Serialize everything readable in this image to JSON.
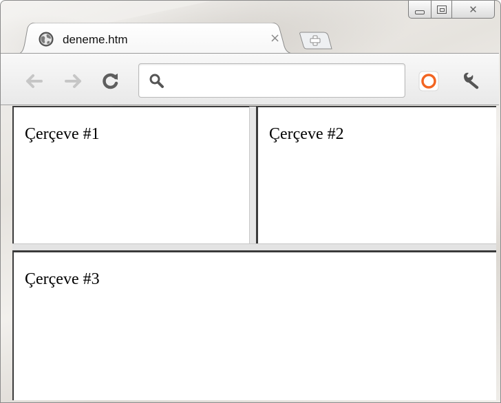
{
  "window": {
    "controls": {
      "minimize": "minimize-icon",
      "maximize": "maximize-icon",
      "close": "close-icon"
    }
  },
  "tab": {
    "title": "deneme.htm",
    "close_glyph": "×",
    "icon": "globe-icon"
  },
  "new_tab": {
    "icon": "new-tab-icon"
  },
  "toolbar": {
    "back_icon": "back-arrow-icon",
    "forward_icon": "forward-arrow-icon",
    "reload_icon": "reload-icon",
    "omnibox": {
      "value": "",
      "icon": "search-icon"
    },
    "extension_icon": "extension-icon",
    "wrench_icon": "wrench-icon"
  },
  "frames": [
    {
      "label": "Çerçeve #1"
    },
    {
      "label": "Çerçeve #2"
    },
    {
      "label": "Çerçeve #3"
    }
  ],
  "colors": {
    "extension_accent": "#f26522",
    "frame_border": "#3a3a3a"
  }
}
